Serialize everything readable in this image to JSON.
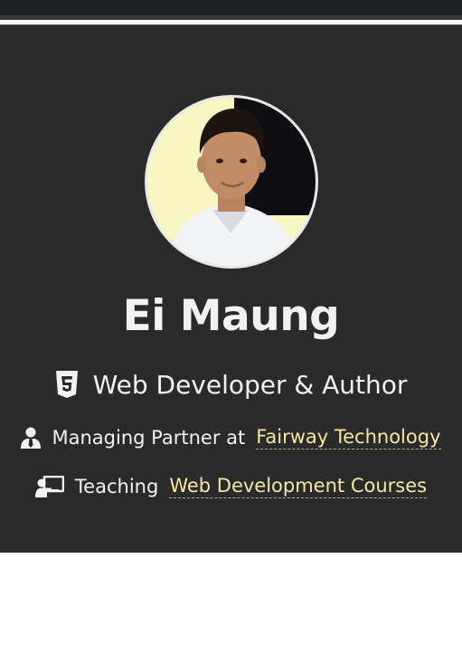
{
  "profile": {
    "name": "Ei Maung",
    "role": "Web Developer & Author",
    "partner_prefix": "Managing Partner at",
    "partner_link": "Fairway Technology",
    "teaching_prefix": "Teaching",
    "teaching_link": "Web Development Courses",
    "icons": {
      "role": "html5-icon",
      "partner": "user-tie-icon",
      "teaching": "chalkboard-teacher-icon"
    }
  },
  "colors": {
    "card_background": "#2a2a2a",
    "text": "#f2f2f2",
    "link": "#f5e7a3",
    "avatar_background": "#f8f6c2"
  }
}
